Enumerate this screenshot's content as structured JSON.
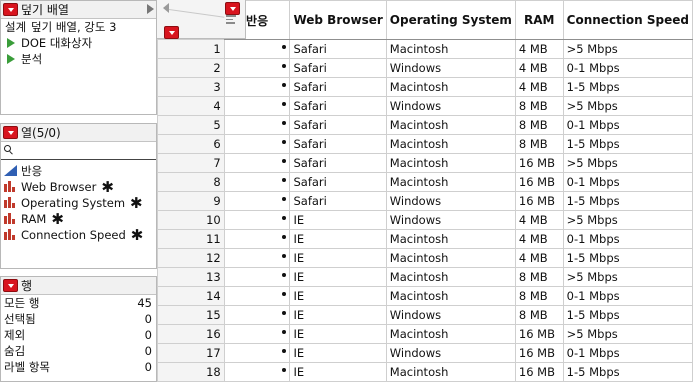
{
  "design_panel": {
    "title": "덮기 배열",
    "rows": [
      {
        "label": "설계",
        "value": "덮기 배열, 강도 3"
      }
    ],
    "scripts": [
      "DOE 대화상자",
      "분석"
    ]
  },
  "columns_panel": {
    "title": "열(5/0)",
    "search_placeholder": "",
    "items": [
      {
        "label": "반응",
        "type": "continuous",
        "locked": false
      },
      {
        "label": "Web Browser",
        "type": "nominal",
        "locked": true
      },
      {
        "label": "Operating System",
        "type": "nominal",
        "locked": true
      },
      {
        "label": "RAM",
        "type": "nominal",
        "locked": true
      },
      {
        "label": "Connection Speed",
        "type": "nominal",
        "locked": true
      }
    ],
    "lock_glyph": "✱"
  },
  "rows_panel": {
    "title": "행",
    "stats": [
      {
        "label": "모든 행",
        "value": "45"
      },
      {
        "label": "선택됨",
        "value": "0"
      },
      {
        "label": "제외",
        "value": "0"
      },
      {
        "label": "숨김",
        "value": "0"
      },
      {
        "label": "라벨 항목",
        "value": "0"
      }
    ]
  },
  "table": {
    "headers": [
      "반응",
      "Web Browser",
      "Operating System",
      "RAM",
      "Connection Speed"
    ],
    "rows": [
      [
        "1",
        "Safari",
        "Macintosh",
        "4 MB",
        ">5 Mbps"
      ],
      [
        "2",
        "Safari",
        "Windows",
        "4 MB",
        "0-1 Mbps"
      ],
      [
        "3",
        "Safari",
        "Macintosh",
        "4 MB",
        "1-5 Mbps"
      ],
      [
        "4",
        "Safari",
        "Windows",
        "8 MB",
        ">5 Mbps"
      ],
      [
        "5",
        "Safari",
        "Macintosh",
        "8 MB",
        "0-1 Mbps"
      ],
      [
        "6",
        "Safari",
        "Macintosh",
        "8 MB",
        "1-5 Mbps"
      ],
      [
        "7",
        "Safari",
        "Macintosh",
        "16 MB",
        ">5 Mbps"
      ],
      [
        "8",
        "Safari",
        "Macintosh",
        "16 MB",
        "0-1 Mbps"
      ],
      [
        "9",
        "Safari",
        "Windows",
        "16 MB",
        "1-5 Mbps"
      ],
      [
        "10",
        "IE",
        "Windows",
        "4 MB",
        ">5 Mbps"
      ],
      [
        "11",
        "IE",
        "Macintosh",
        "4 MB",
        "0-1 Mbps"
      ],
      [
        "12",
        "IE",
        "Macintosh",
        "4 MB",
        "1-5 Mbps"
      ],
      [
        "13",
        "IE",
        "Macintosh",
        "8 MB",
        ">5 Mbps"
      ],
      [
        "14",
        "IE",
        "Macintosh",
        "8 MB",
        "0-1 Mbps"
      ],
      [
        "15",
        "IE",
        "Windows",
        "8 MB",
        "1-5 Mbps"
      ],
      [
        "16",
        "IE",
        "Macintosh",
        "16 MB",
        ">5 Mbps"
      ],
      [
        "17",
        "IE",
        "Windows",
        "16 MB",
        "0-1 Mbps"
      ],
      [
        "18",
        "IE",
        "Macintosh",
        "16 MB",
        "1-5 Mbps"
      ]
    ]
  },
  "colors": {
    "hotspot_red": "#d8141e",
    "script_green": "#3a9d3a",
    "continuous_blue": "#2f5fb3",
    "nominal_red": "#c0392b"
  }
}
